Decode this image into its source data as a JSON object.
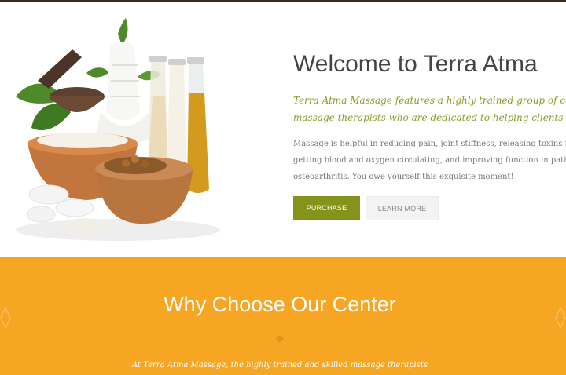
{
  "hero": {
    "title": "Welcome to Terra Atma",
    "intro": "Terra Atma Massage features a highly trained group of certified massage therapists who are dedicated to helping clients improve",
    "body": "Massage is helpful in reducing pain, joint stiffness, releasing toxins from muscles, getting blood and oxygen circulating, and improving function in patients with osteoarthritis. You owe yourself this exquisite moment!",
    "purchase_label": "PURCHASE",
    "learn_more_label": "LEARN MORE"
  },
  "why": {
    "title": "Why Choose Our Center",
    "text": "At Terra Atma Massage, the highly trained and skilled massage therapists"
  },
  "colors": {
    "accent_green": "#86931a",
    "section_orange": "#f6a623",
    "intro_text_green": "#8a9a2a"
  }
}
